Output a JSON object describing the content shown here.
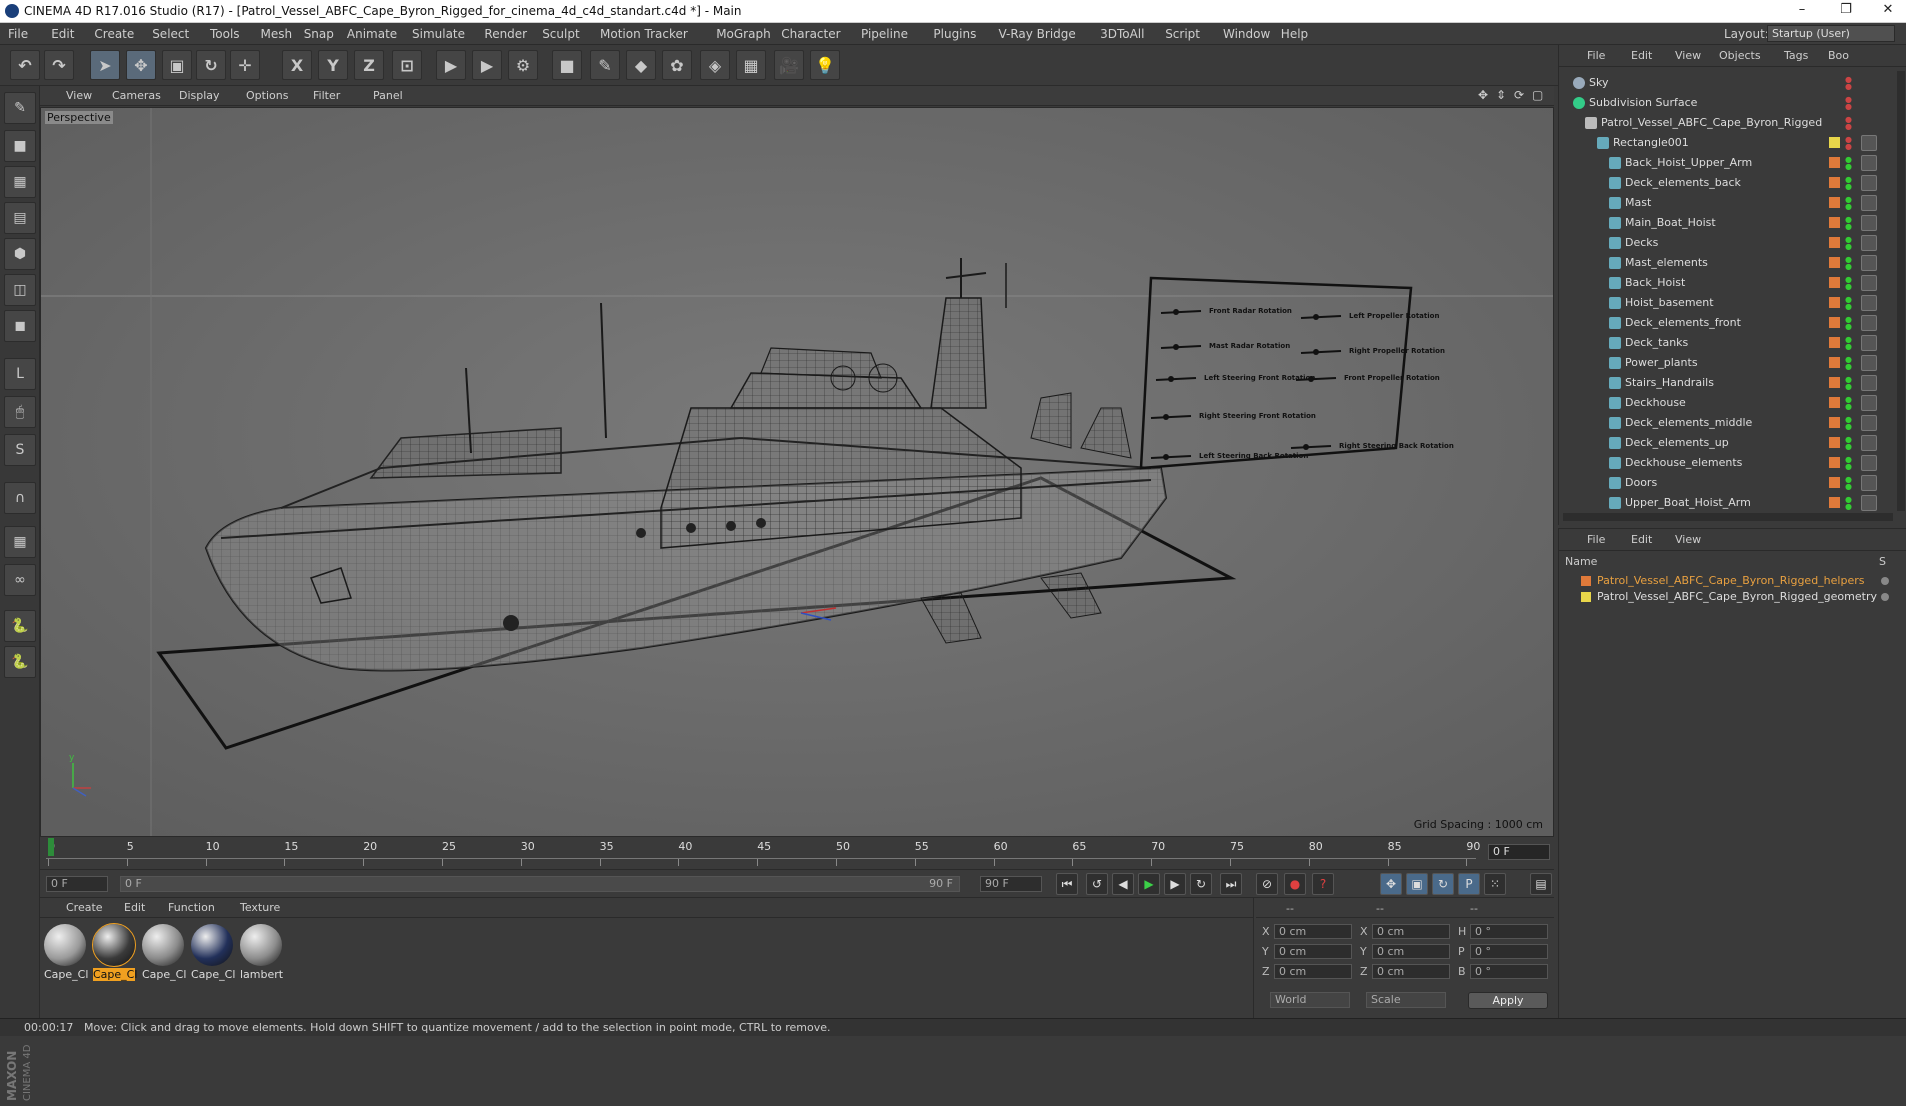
{
  "window": {
    "title": "CINEMA 4D R17.016 Studio (R17) - [Patrol_Vessel_ABFC_Cape_Byron_Rigged_for_cinema_4d_c4d_standart.c4d *] - Main",
    "minimize": "–",
    "restore": "❐",
    "close": "✕"
  },
  "menubar": {
    "items": [
      "File",
      "Edit",
      "Create",
      "Select",
      "Tools",
      "Mesh",
      "Snap",
      "Animate",
      "Simulate",
      "Render",
      "Sculpt",
      "Motion Tracker",
      "MoGraph",
      "Character",
      "Pipeline",
      "Plugins",
      "V-Ray Bridge",
      "3DToAll",
      "Script",
      "Window",
      "Help"
    ],
    "layout_label": "Layout:",
    "layout_value": "Startup (User)"
  },
  "toolbar": {
    "tools": [
      {
        "name": "undo-icon",
        "glyph": "↶"
      },
      {
        "name": "redo-icon",
        "glyph": "↷"
      },
      {
        "name": "select-arrow-icon",
        "glyph": "➤"
      },
      {
        "name": "move-icon",
        "glyph": "✥"
      },
      {
        "name": "scale-icon",
        "glyph": "▣"
      },
      {
        "name": "rotate-icon",
        "glyph": "↻"
      },
      {
        "name": "live-select-icon",
        "glyph": "✛"
      },
      {
        "name": "x-axis-icon",
        "glyph": "X"
      },
      {
        "name": "y-axis-icon",
        "glyph": "Y"
      },
      {
        "name": "z-axis-icon",
        "glyph": "Z"
      },
      {
        "name": "coordinate-system-icon",
        "glyph": "⊡"
      },
      {
        "name": "render-view-icon",
        "glyph": "▶"
      },
      {
        "name": "render-picture-viewer-icon",
        "glyph": "▶"
      },
      {
        "name": "render-settings-icon",
        "glyph": "⚙"
      },
      {
        "name": "cube-icon",
        "glyph": "■"
      },
      {
        "name": "spline-pen-icon",
        "glyph": "✎"
      },
      {
        "name": "subdivision-icon",
        "glyph": "◆"
      },
      {
        "name": "cloner-icon",
        "glyph": "✿"
      },
      {
        "name": "deformer-icon",
        "glyph": "◈"
      },
      {
        "name": "floor-icon",
        "glyph": "▦"
      },
      {
        "name": "camera-icon",
        "glyph": "🎥"
      },
      {
        "name": "light-icon",
        "glyph": "💡"
      }
    ]
  },
  "left_tools": [
    "make-editable-icon",
    "model-mode-icon",
    "texture-mode-icon",
    "workplane-icon",
    "points-mode-icon",
    "edges-mode-icon",
    "polygons-mode-icon",
    "axis-mode-icon",
    "tweak-mode-icon",
    "solo-icon",
    "magnet-icon",
    "snap-grid-icon",
    "snap-icon",
    "python-icon",
    "python-script-icon"
  ],
  "viewport": {
    "menu": [
      "View",
      "Cameras",
      "Display",
      "Options",
      "Filter",
      "Panel"
    ],
    "label": "Perspective",
    "grid_spacing": "Grid Spacing : 1000 cm",
    "controls_board": [
      "Front Radar Rotation",
      "Left Propeller Rotation",
      "Mast Radar Rotation",
      "Right Propeller Rotation",
      "Left Steering Front Rotation",
      "Front Propeller Rotation",
      "Right Steering Front Rotation",
      "Left Steering Back Rotation",
      "Right Steering Back Rotation"
    ]
  },
  "timeline": {
    "ticks": [
      "0",
      "5",
      "10",
      "15",
      "20",
      "25",
      "30",
      "35",
      "40",
      "45",
      "50",
      "55",
      "60",
      "65",
      "70",
      "75",
      "80",
      "85",
      "90"
    ],
    "current_frame": "0 F"
  },
  "transport": {
    "start_field": "0 F",
    "range_start": "0 F",
    "range_end": "90 F",
    "end_field": "90 F"
  },
  "materials": {
    "menu": [
      "Create",
      "Edit",
      "Function",
      "Texture"
    ],
    "items": [
      {
        "label": "Cape_Cl",
        "color": "#9a9a9a"
      },
      {
        "label": "Cape_Cl",
        "color": "#3a3a3a",
        "selected": true
      },
      {
        "label": "Cape_Cl",
        "color": "#8a8a8a"
      },
      {
        "label": "Cape_Cl",
        "color": "#22305a"
      },
      {
        "label": "lambert",
        "color": "#8c8c8c"
      }
    ]
  },
  "coordinates": {
    "header": [
      "--",
      "--",
      "--"
    ],
    "rows": [
      {
        "a": "X",
        "av": "0 cm",
        "b": "X",
        "bv": "0 cm",
        "c": "H",
        "cv": "0 °"
      },
      {
        "a": "Y",
        "av": "0 cm",
        "b": "Y",
        "bv": "0 cm",
        "c": "P",
        "cv": "0 °"
      },
      {
        "a": "Z",
        "av": "0 cm",
        "b": "Z",
        "bv": "0 cm",
        "c": "B",
        "cv": "0 °"
      }
    ],
    "mode1": "World",
    "mode2": "Scale",
    "apply": "Apply"
  },
  "objects_panel": {
    "menu": [
      "File",
      "Edit",
      "View",
      "Objects",
      "Tags",
      "Boo"
    ],
    "items": [
      {
        "name": "Sky",
        "indent": 0,
        "icon": "sky-icon",
        "swatch": null
      },
      {
        "name": "Subdivision Surface",
        "indent": 0,
        "icon": "subdivision-icon",
        "swatch": null
      },
      {
        "name": "Patrol_Vessel_ABFC_Cape_Byron_Rigged",
        "indent": 1,
        "icon": "null-object-icon",
        "swatch": null
      },
      {
        "name": "Rectangle001",
        "indent": 2,
        "icon": "spline-icon",
        "swatch": "#e8d64a"
      },
      {
        "name": "Back_Hoist_Upper_Arm",
        "indent": 3,
        "icon": "bone-icon",
        "swatch": "#e07a3a"
      },
      {
        "name": "Deck_elements_back",
        "indent": 3,
        "icon": "bone-icon",
        "swatch": "#e07a3a"
      },
      {
        "name": "Mast",
        "indent": 3,
        "icon": "bone-icon",
        "swatch": "#e07a3a"
      },
      {
        "name": "Main_Boat_Hoist",
        "indent": 3,
        "icon": "bone-icon",
        "swatch": "#e07a3a"
      },
      {
        "name": "Decks",
        "indent": 3,
        "icon": "bone-icon",
        "swatch": "#e07a3a"
      },
      {
        "name": "Mast_elements",
        "indent": 3,
        "icon": "bone-icon",
        "swatch": "#e07a3a"
      },
      {
        "name": "Back_Hoist",
        "indent": 3,
        "icon": "bone-icon",
        "swatch": "#e07a3a"
      },
      {
        "name": "Hoist_basement",
        "indent": 3,
        "icon": "bone-icon",
        "swatch": "#e07a3a"
      },
      {
        "name": "Deck_elements_front",
        "indent": 3,
        "icon": "bone-icon",
        "swatch": "#e07a3a"
      },
      {
        "name": "Deck_tanks",
        "indent": 3,
        "icon": "bone-icon",
        "swatch": "#e07a3a"
      },
      {
        "name": "Power_plants",
        "indent": 3,
        "icon": "bone-icon",
        "swatch": "#e07a3a"
      },
      {
        "name": "Stairs_Handrails",
        "indent": 3,
        "icon": "bone-icon",
        "swatch": "#e07a3a"
      },
      {
        "name": "Deckhouse",
        "indent": 3,
        "icon": "bone-icon",
        "swatch": "#e07a3a"
      },
      {
        "name": "Deck_elements_middle",
        "indent": 3,
        "icon": "bone-icon",
        "swatch": "#e07a3a"
      },
      {
        "name": "Deck_elements_up",
        "indent": 3,
        "icon": "bone-icon",
        "swatch": "#e07a3a"
      },
      {
        "name": "Deckhouse_elements",
        "indent": 3,
        "icon": "bone-icon",
        "swatch": "#e07a3a"
      },
      {
        "name": "Doors",
        "indent": 3,
        "icon": "bone-icon",
        "swatch": "#e07a3a"
      },
      {
        "name": "Upper_Boat_Hoist_Arm",
        "indent": 3,
        "icon": "bone-icon",
        "swatch": "#e07a3a"
      }
    ]
  },
  "layers_panel": {
    "menu": [
      "File",
      "Edit",
      "View"
    ],
    "column_name": "Name",
    "column_s": "S",
    "items": [
      {
        "name": "Patrol_Vessel_ABFC_Cape_Byron_Rigged_helpers",
        "color": "#e07a3a",
        "text_color": "#e8a040"
      },
      {
        "name": "Patrol_Vessel_ABFC_Cape_Byron_Rigged_geometry",
        "color": "#e8d64a",
        "text_color": "#dddddd"
      }
    ]
  },
  "status": {
    "time": "00:00:17",
    "message": "Move: Click and drag to move elements. Hold down SHIFT to quantize movement / add to the selection in point mode, CTRL to remove."
  },
  "branding": {
    "maxon": "MAXON",
    "cinema": "CINEMA 4D"
  }
}
